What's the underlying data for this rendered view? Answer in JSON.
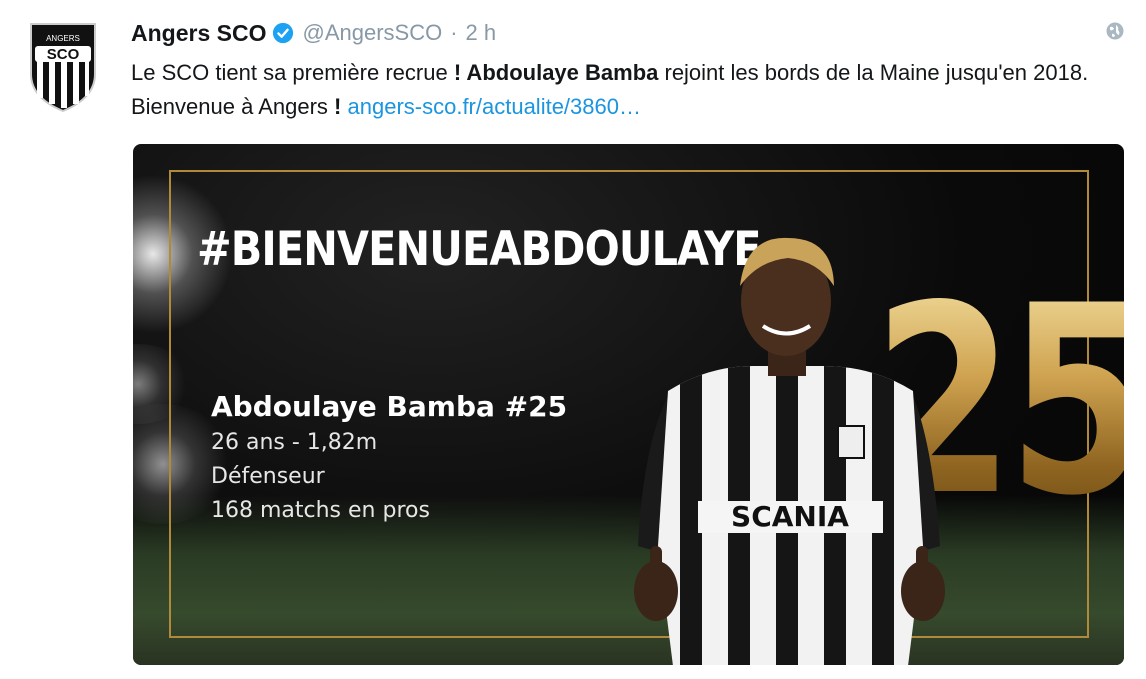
{
  "tweet": {
    "author_name": "Angers SCO",
    "handle": "@AngersSCO",
    "separator": "·",
    "time": "2 h",
    "text_part1": "Le SCO tient sa première recrue ",
    "text_bold": "! Abdoulaye Bamba",
    "text_part2": " rejoint les bords de la Maine jusqu'en 2018. Bienvenue à Angers ",
    "text_excl": "!",
    "link": "angers-sco.fr/actualite/3860…",
    "avatar_text": "SCO",
    "avatar_top": "ANGERS"
  },
  "media": {
    "hashtag": "#BIENVENUEABDOULAYE",
    "number": "25",
    "player_name": "Abdoulaye Bamba #25",
    "info": [
      "26 ans - 1,82m",
      "Défenseur",
      "168 matchs en pros"
    ],
    "sponsor": "SCANIA"
  },
  "colors": {
    "link": "#1b95e0",
    "gold": "#c9a14a",
    "verified": "#1da1f2",
    "muted": "#8899a6"
  },
  "icons": {
    "verified": "verified-badge-icon",
    "globe": "globe-icon"
  }
}
